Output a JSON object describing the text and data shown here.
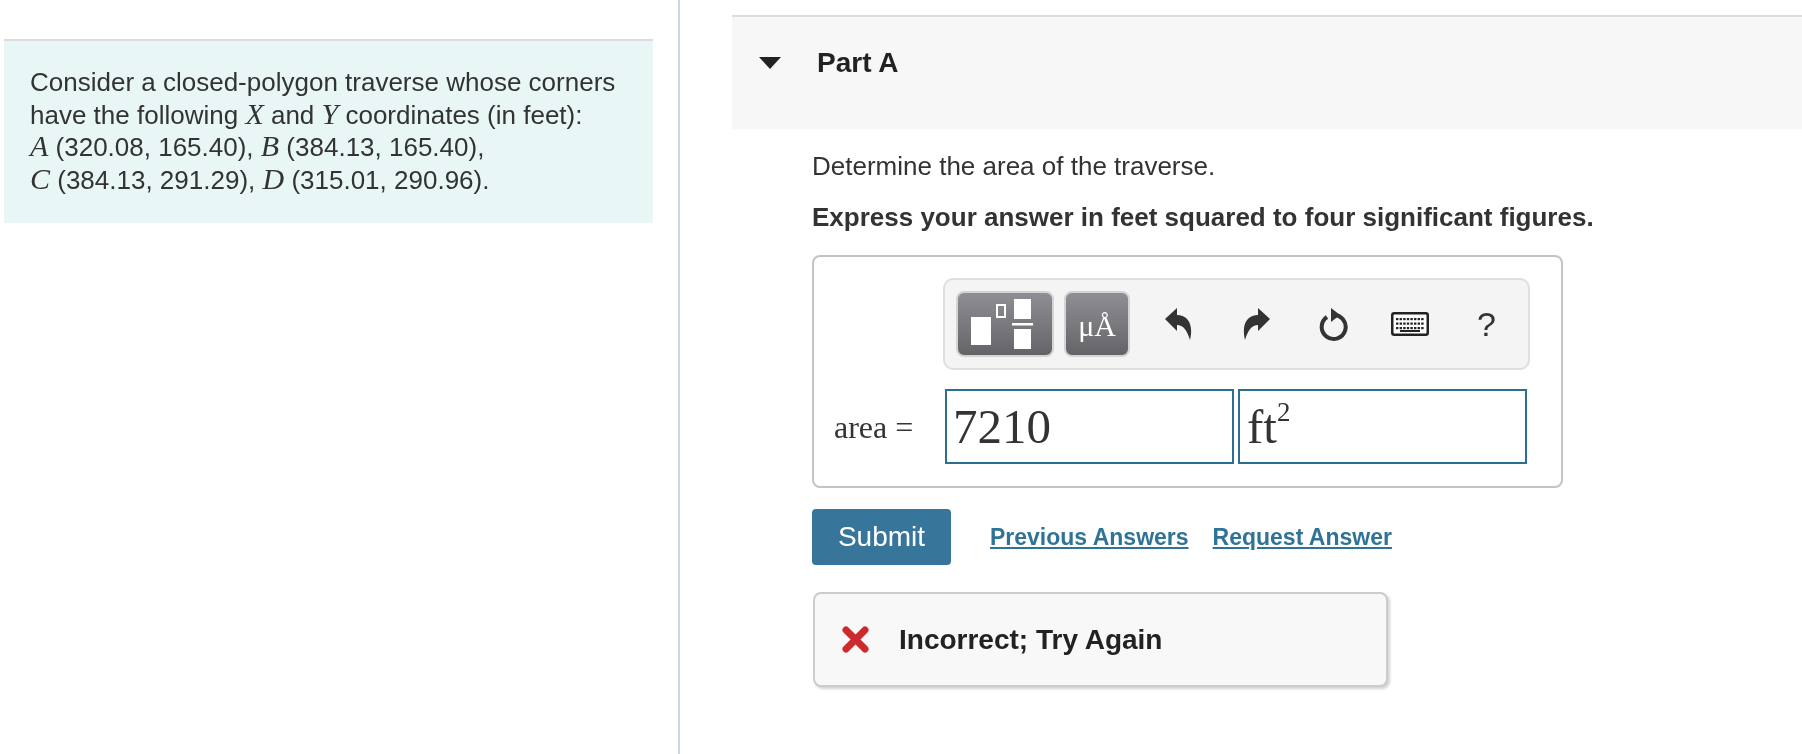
{
  "problem": {
    "text_lines": [
      "Consider a closed-polygon traverse whose corners have the following *X* and *Y* coordinates (in feet):",
      "*A* (320.08, 165.40), *B* (384.13, 165.40),",
      "*C* (384.13, 291.29), *D* (315.01, 290.96)."
    ]
  },
  "part": {
    "title": "Part A",
    "expanded": true,
    "question": "Determine the area of the traverse.",
    "instruction": "Express your answer in feet squared to four significant figures."
  },
  "answer": {
    "toolbar": {
      "units_button": "μÅ",
      "help_button": "?"
    },
    "label": "area =",
    "value": "7210",
    "units": "ft$^{2}$"
  },
  "actions": {
    "submit": "Submit",
    "links": [
      "Previous Answers",
      "Request Answer"
    ]
  },
  "feedback": {
    "kind": "incorrect",
    "message": "Incorrect; Try Again"
  }
}
